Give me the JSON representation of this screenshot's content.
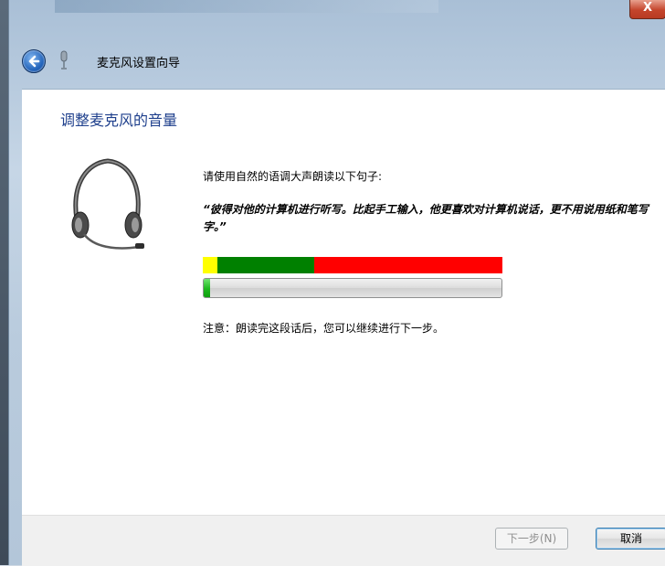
{
  "window": {
    "title": "麦克风设置向导",
    "close_label": "X"
  },
  "page": {
    "heading": "调整麦克风的音量",
    "instruction": "请使用自然的语调大声朗读以下句子:",
    "quote": "“彼得对他的计算机进行听写。比起手工输入，他更喜欢对计算机说话，更不用说用纸和笔写字。”",
    "note": "注意：朗读完这段话后，您可以继续进行下一步。"
  },
  "level_indicator": {
    "zones": [
      {
        "name": "yellow",
        "color": "#ffff00"
      },
      {
        "name": "green",
        "color": "#008000"
      },
      {
        "name": "red",
        "color": "#ff0000"
      }
    ],
    "current_level": 0.02
  },
  "buttons": {
    "next_label": "下一步(N)",
    "cancel_label": "取消"
  },
  "icons": {
    "back": "back-arrow-icon",
    "microphone": "microphone-icon",
    "headset": "headset-icon"
  }
}
